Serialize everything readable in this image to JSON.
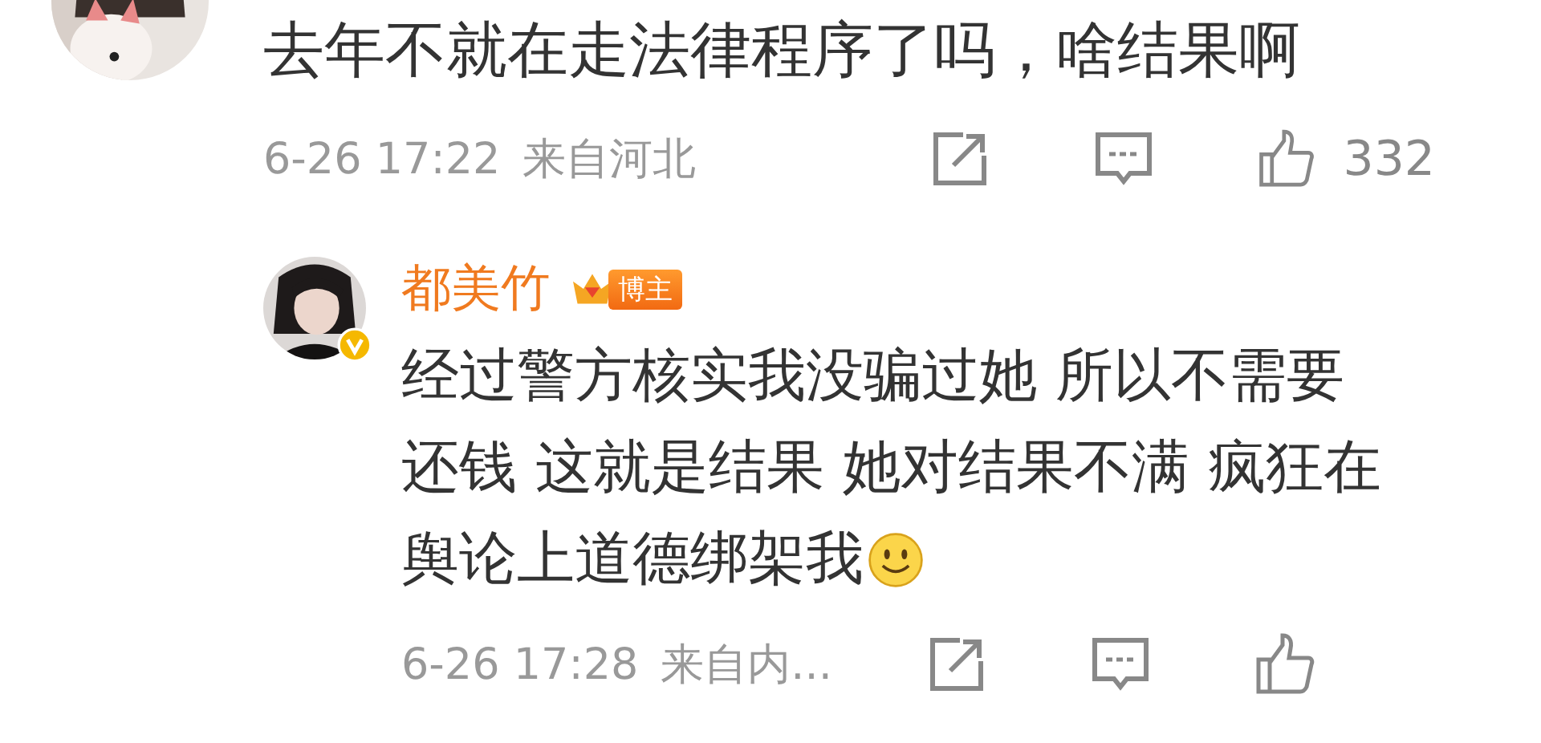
{
  "comment": {
    "text": "去年不就在走法律程序了吗，啥结果啊",
    "time": "6-26 17:22",
    "location": "来自河北",
    "likes": "332"
  },
  "reply": {
    "author": "都美竹",
    "badge": "博主",
    "verified": true,
    "lines": [
      "经过警方核实我没骗过她 所以不需要",
      "还钱 这就是结果 她对结果不满 疯狂在",
      "舆论上道德绑架我"
    ],
    "time": "6-26 17:28",
    "location": "来自内..."
  }
}
